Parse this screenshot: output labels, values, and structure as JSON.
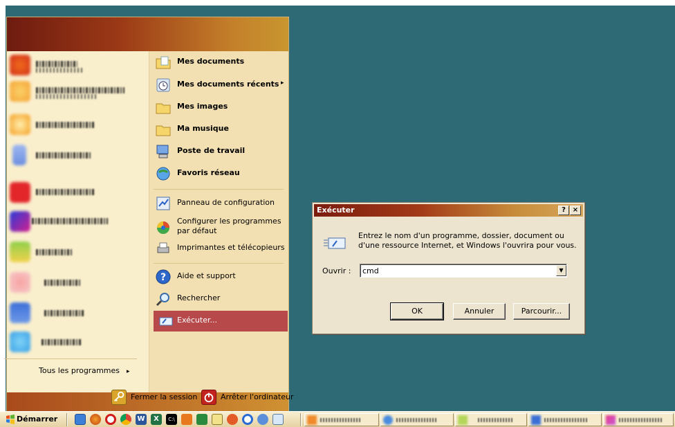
{
  "start_menu": {
    "right_items": [
      {
        "label": "Mes documents",
        "icon": "my-documents-icon",
        "bold": true
      },
      {
        "label": "Mes documents récents",
        "icon": "recent-documents-icon",
        "bold": true,
        "arrow": "▸"
      },
      {
        "label": "Mes images",
        "icon": "my-pictures-icon",
        "bold": true
      },
      {
        "label": "Ma musique",
        "icon": "my-music-icon",
        "bold": true
      },
      {
        "label": "Poste de travail",
        "icon": "my-computer-icon",
        "bold": true
      },
      {
        "label": "Favoris réseau",
        "icon": "network-places-icon",
        "bold": true
      },
      {
        "label": "Panneau de configuration",
        "icon": "control-panel-icon"
      },
      {
        "label_line1": "Configurer les programmes",
        "label_line2": "par défaut",
        "icon": "default-programs-icon"
      },
      {
        "label": "Imprimantes et télécopieurs",
        "icon": "printers-icon"
      },
      {
        "label": "Aide et support",
        "icon": "help-icon"
      },
      {
        "label": "Rechercher",
        "icon": "search-icon"
      },
      {
        "label": "Exécuter...",
        "icon": "run-icon",
        "selected": true
      }
    ],
    "all_programs": "Tous les programmes",
    "all_programs_arrow": "▸",
    "logoff": "Fermer la session",
    "shutdown": "Arrêter l'ordinateur"
  },
  "run_dialog": {
    "title": "Exécuter",
    "help_btn": "?",
    "close_btn": "×",
    "description": "Entrez le nom d'un programme, dossier, document ou d'une ressource Internet, et Windows l'ouvrira pour vous.",
    "open_label": "Ouvrir :",
    "input_value": "cmd",
    "ok": "OK",
    "cancel": "Annuler",
    "browse": "Parcourir..."
  },
  "taskbar": {
    "start_label": "Démarrer"
  },
  "colors": {
    "desktop": "#2e6a76",
    "menu_header": "#9b3916",
    "selected_item": "#b7494b"
  }
}
